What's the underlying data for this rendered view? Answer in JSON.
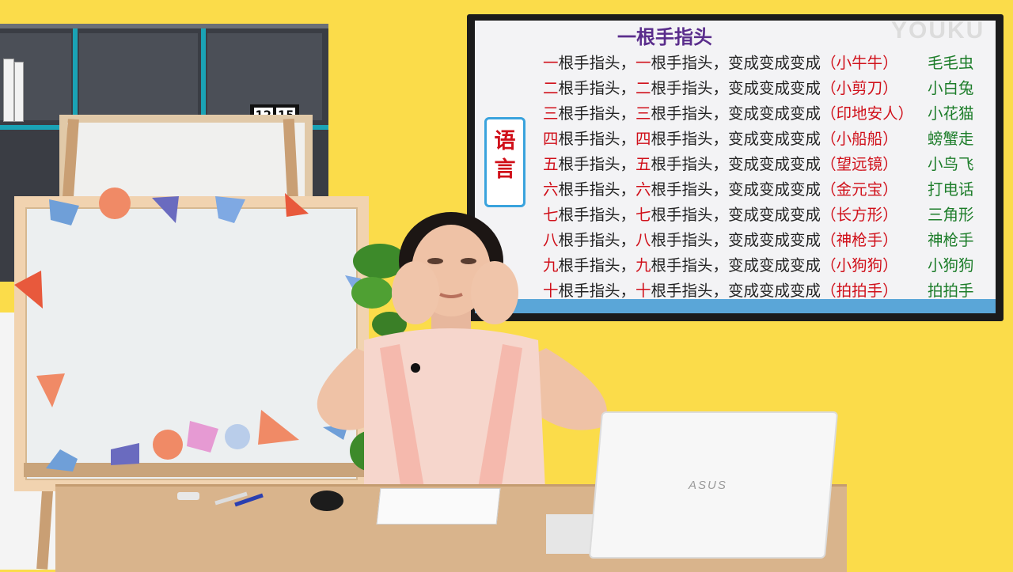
{
  "slide": {
    "title": "一根手指头",
    "side_label": [
      "语",
      "言"
    ],
    "verses": [
      {
        "num": "一",
        "a": "根手指头，",
        "num2": "一",
        "b": "根手指头，变成变成变成",
        "paren": "（小牛牛）",
        "res": "毛毛虫"
      },
      {
        "num": "二",
        "a": "根手指头，",
        "num2": "二",
        "b": "根手指头，变成变成变成",
        "paren": "（小剪刀）",
        "res": "小白兔"
      },
      {
        "num": "三",
        "a": "根手指头，",
        "num2": "三",
        "b": "根手指头，变成变成变成",
        "paren": "（印地安人）",
        "res": "小花猫"
      },
      {
        "num": "四",
        "a": "根手指头，",
        "num2": "四",
        "b": "根手指头，变成变成变成",
        "paren": "（小船船）",
        "res": "螃蟹走"
      },
      {
        "num": "五",
        "a": "根手指头，",
        "num2": "五",
        "b": "根手指头，变成变成变成",
        "paren": "（望远镜）",
        "res": "小鸟飞"
      },
      {
        "num": "六",
        "a": "根手指头，",
        "num2": "六",
        "b": "根手指头，变成变成变成",
        "paren": "（金元宝）",
        "res": "打电话"
      },
      {
        "num": "七",
        "a": "根手指头，",
        "num2": "七",
        "b": "根手指头，变成变成变成",
        "paren": "（长方形）",
        "res": "三角形"
      },
      {
        "num": "八",
        "a": "根手指头，",
        "num2": "八",
        "b": "根手指头，变成变成变成",
        "paren": "（神枪手）",
        "res": "神枪手"
      },
      {
        "num": "九",
        "a": "根手指头，",
        "num2": "九",
        "b": "根手指头，变成变成变成",
        "paren": "（小狗狗）",
        "res": "小狗狗"
      },
      {
        "num": "十",
        "a": "根手指头，",
        "num2": "十",
        "b": "根手指头，变成变成变成",
        "paren": "（拍拍手）",
        "res": "拍拍手"
      }
    ]
  },
  "watermark": "YOUKU",
  "clock": {
    "hours": "12",
    "minutes": "15"
  },
  "laptop_brand": "ASUS",
  "colors": {
    "wall": "#fbdc4a",
    "title": "#5a2d8c",
    "number_red": "#d0101a",
    "result_green": "#1d7d2a",
    "scroll_border": "#3aa3dd"
  }
}
